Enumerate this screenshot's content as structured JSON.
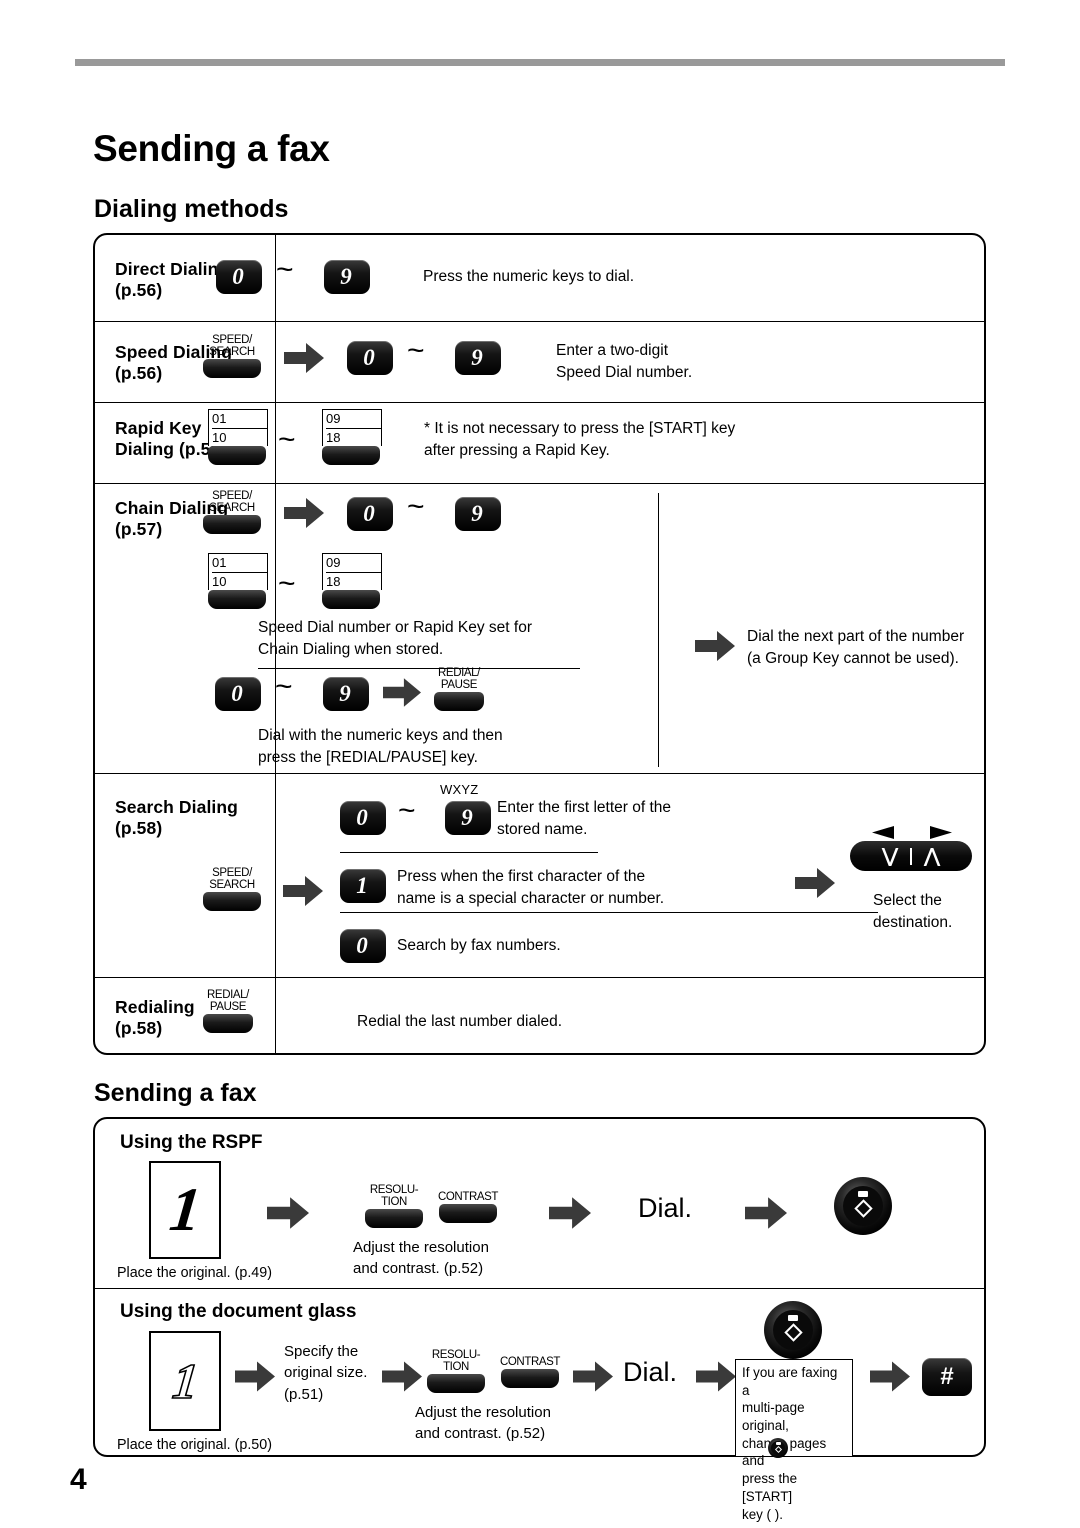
{
  "document": {
    "title": "Sending a fax",
    "page_number": "4"
  },
  "sections": {
    "dialing_methods": {
      "heading": "Dialing methods",
      "rows": [
        {
          "label": "Direct Dialing\n(p.56)",
          "keys": {
            "from": "0",
            "to": "9",
            "range_symbol": "~"
          },
          "note": "Press the numeric keys to dial."
        },
        {
          "label": "Speed Dialing\n(p.56)",
          "speed_search_key": "SPEED/\nSEARCH",
          "keys": {
            "from": "0",
            "to": "9",
            "range_symbol": "~"
          },
          "note": "Enter a two-digit\nSpeed Dial number."
        },
        {
          "label": "Rapid Key\nDialing (p.56)",
          "rapid_key_from": {
            "top": "01",
            "bottom": "10"
          },
          "rapid_key_to": {
            "top": "09",
            "bottom": "18"
          },
          "range_symbol": "~",
          "note": "* It is not necessary to press the [START] key\n   after pressing a Rapid Key."
        },
        {
          "label": "Chain Dialing\n(p.57)",
          "speed_search_key": "SPEED/\nSEARCH",
          "keys": {
            "from": "0",
            "to": "9",
            "range_symbol": "~"
          },
          "rapid_key_from": {
            "top": "01",
            "bottom": "10"
          },
          "rapid_key_to": {
            "top": "09",
            "bottom": "18"
          },
          "note_stored": "Speed Dial number or Rapid Key set for\nChain Dialing when stored.",
          "redial_pause_key": "REDIAL/\nPAUSE",
          "note_numeric": "Dial with the numeric keys and then\npress the [REDIAL/PAUSE] key.",
          "note_next": "Dial the next part of the number\n(a Group Key cannot be used)."
        },
        {
          "label": "Search Dialing\n(p.58)",
          "speed_search_key": "SPEED/\nSEARCH",
          "step_letter": {
            "from": "0",
            "to": "9",
            "range_symbol": "~",
            "above_label": "WXYZ",
            "note": "Enter the first letter of the\nstored name."
          },
          "step_special": {
            "key": "1",
            "note": "Press when the first character of the\nname is a special character or number."
          },
          "step_fax": {
            "key": "0",
            "note": "Search by fax numbers."
          },
          "nav_note": "Select the\ndestination."
        },
        {
          "label": "Redialing\n(p.58)",
          "redial_pause_key": "REDIAL/\nPAUSE",
          "note": "Redial the last number dialed."
        }
      ]
    },
    "sending_a_fax": {
      "heading": "Sending a fax",
      "blocks": [
        {
          "subhead": "Using the RSPF",
          "original_glyph": "1",
          "original_caption": "Place the original. (p.49)",
          "resolution_key": "RESOLU-\nTION",
          "contrast_key": "CONTRAST",
          "adjust_caption": "Adjust the resolution\nand contrast. (p.52)",
          "dial_label": "Dial.",
          "start_key": "start-key"
        },
        {
          "subhead": "Using the document glass",
          "original_glyph": "1",
          "original_caption": "Place the original. (p.50)",
          "specify_caption": "Specify the\noriginal size.\n(p.51)",
          "resolution_key": "RESOLU-\nTION",
          "contrast_key": "CONTRAST",
          "adjust_caption": "Adjust the resolution\nand contrast. (p.52)",
          "dial_label": "Dial.",
          "callout": "If you are faxing a\nmulti-page original,\nchange pages and\npress the [START]\nkey (  ).",
          "hash_key": "#"
        }
      ]
    }
  },
  "colors": {
    "rule_gray": "#999999",
    "ink": "#000000",
    "paper": "#ffffff"
  }
}
